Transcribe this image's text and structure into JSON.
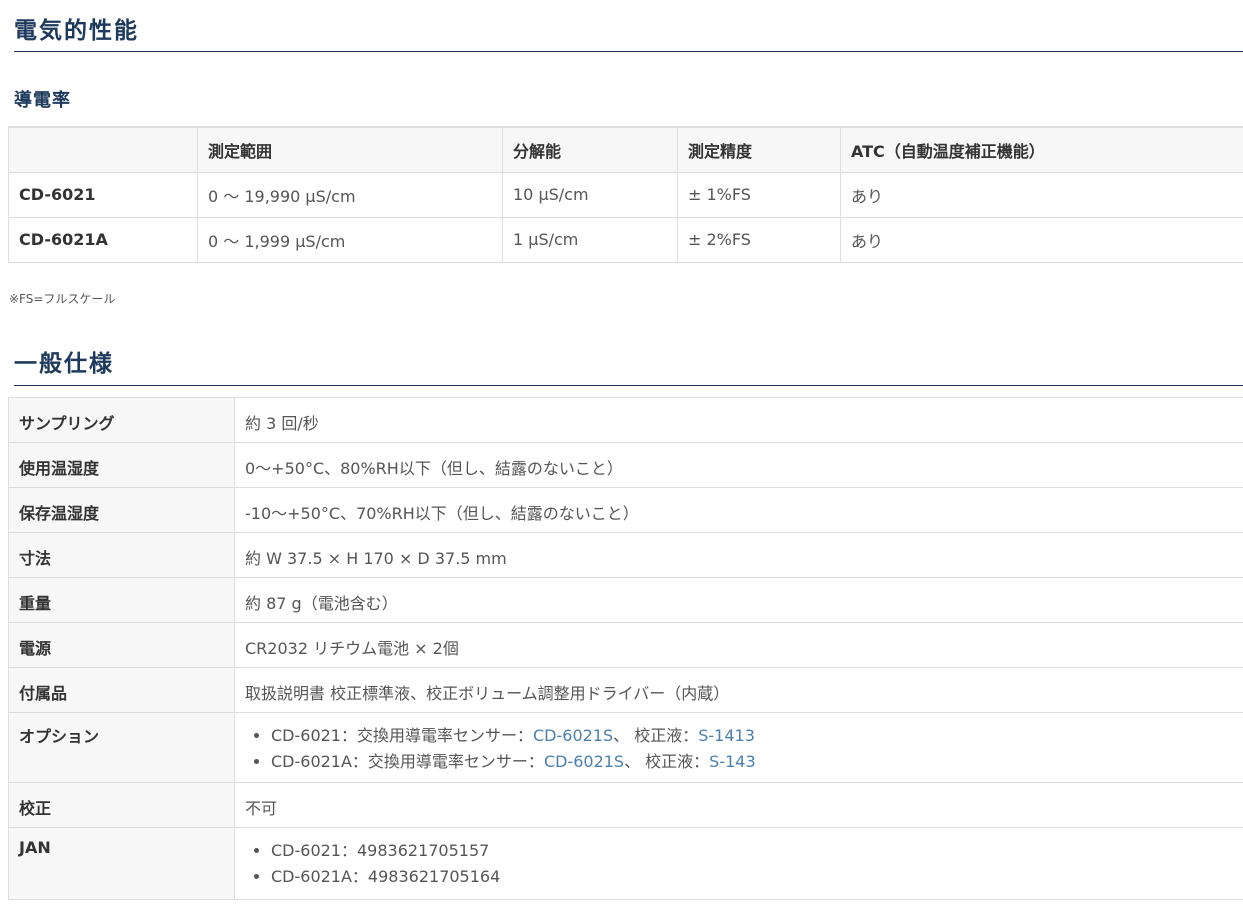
{
  "section1": {
    "title": "電気的性能",
    "subtitle": "導電率",
    "table": {
      "headers": [
        "",
        "測定範囲",
        "分解能",
        "測定精度",
        "ATC（自動温度補正機能）"
      ],
      "rows": [
        {
          "model": "CD-6021",
          "range": "0 ～ 19,990 μS/cm",
          "resolution": "10 μS/cm",
          "accuracy": "± 1%FS",
          "atc": "あり"
        },
        {
          "model": "CD-6021A",
          "range": "0 ～ 1,999 μS/cm",
          "resolution": "1 μS/cm",
          "accuracy": "± 2%FS",
          "atc": "あり"
        }
      ]
    },
    "note": "※FS=フルスケール"
  },
  "section2": {
    "title": "一般仕様",
    "rows": [
      {
        "label": "サンプリング",
        "value": "約 3 回/秒"
      },
      {
        "label": "使用温湿度",
        "value": "0～+50°C、80%RH以下（但し、結露のないこと）"
      },
      {
        "label": "保存温湿度",
        "value": "-10～+50°C、70%RH以下（但し、結露のないこと）"
      },
      {
        "label": "寸法",
        "value": "約 W 37.5 × H 170 × D 37.5 mm"
      },
      {
        "label": "重量",
        "value": "約 87 g（電池含む）"
      },
      {
        "label": "電源",
        "value": "CR2032 リチウム電池 × 2個"
      },
      {
        "label": "付属品",
        "value": "取扱説明書 校正標準液、校正ボリューム調整用ドライバー（内蔵）"
      }
    ],
    "options": {
      "label": "オプション",
      "items": [
        {
          "prefix": "CD-6021：交換用導電率センサー：",
          "sensor_link": "CD-6021S",
          "mid": "、 校正液：",
          "solution_link": "S-1413"
        },
        {
          "prefix": "CD-6021A：交換用導電率センサー：",
          "sensor_link": "CD-6021S",
          "mid": "、 校正液：",
          "solution_link": "S-143"
        }
      ]
    },
    "calibration": {
      "label": "校正",
      "value": "不可"
    },
    "jan": {
      "label": "JAN",
      "items": [
        "CD-6021：4983621705157",
        "CD-6021A：4983621705164"
      ]
    }
  },
  "colors": {
    "heading": "#1d3a5c",
    "link": "#4a7fb0",
    "header_bg": "#f7f7f7",
    "border": "#dddddd"
  }
}
